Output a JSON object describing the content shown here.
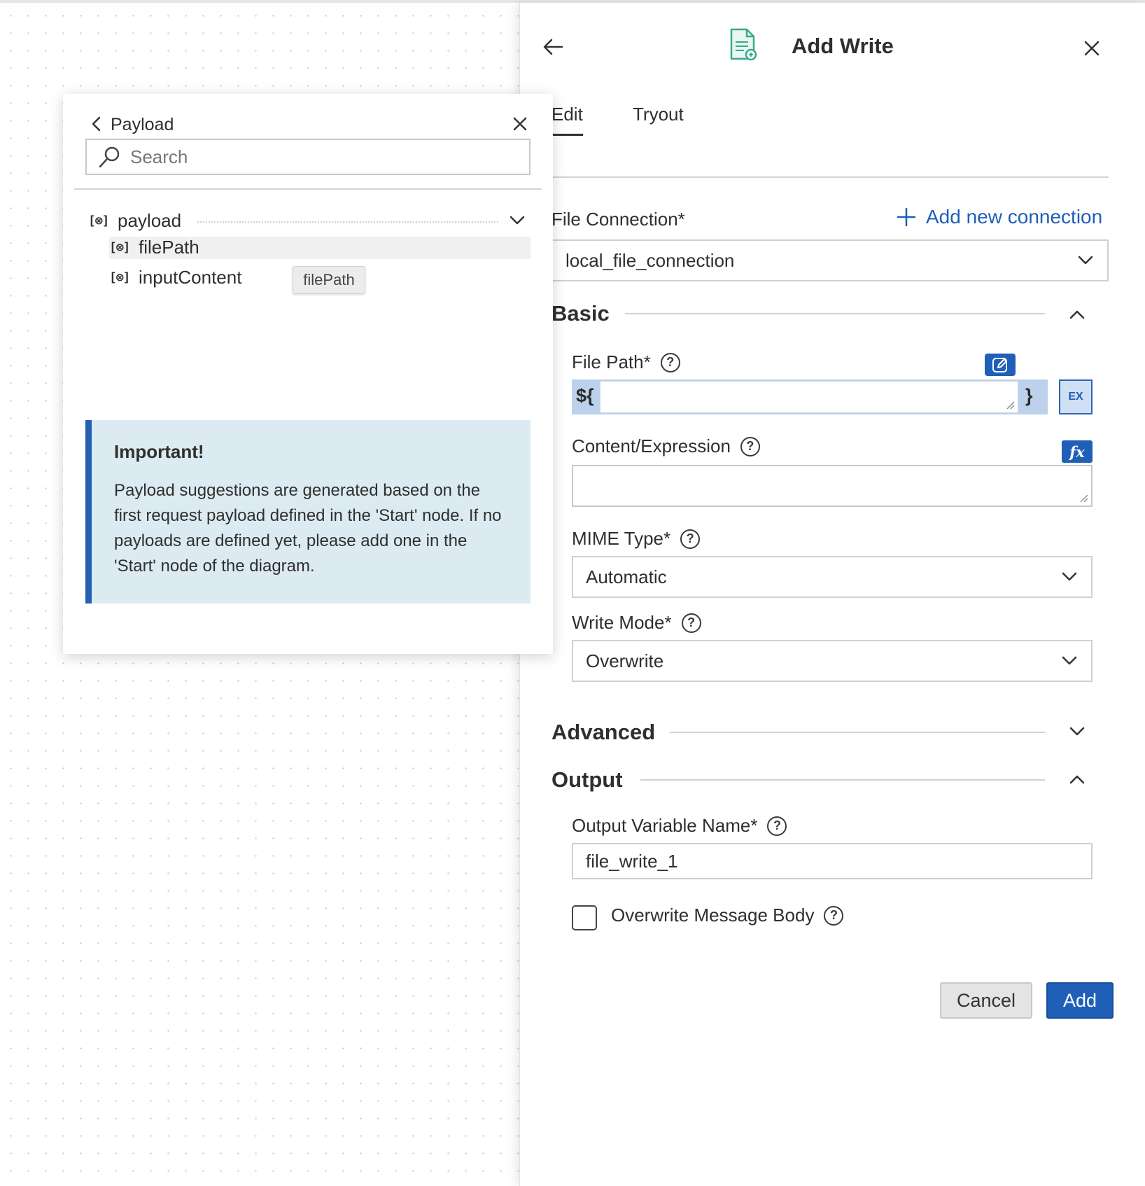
{
  "panel": {
    "title": "Add Write",
    "tabs": [
      {
        "label": "Edit",
        "active": true
      },
      {
        "label": "Tryout",
        "active": false
      }
    ],
    "file_connection": {
      "label": "File Connection*",
      "add_link": "Add new connection",
      "value": "local_file_connection"
    },
    "sections": {
      "basic": "Basic",
      "advanced": "Advanced",
      "output": "Output"
    },
    "file_path": {
      "label": "File Path*",
      "prefix": "${",
      "suffix": "}",
      "ex_label": "EX"
    },
    "content_expression": {
      "label": "Content/Expression",
      "fx_label": "fx"
    },
    "mime_type": {
      "label": "MIME Type*",
      "value": "Automatic"
    },
    "write_mode": {
      "label": "Write Mode*",
      "value": "Overwrite"
    },
    "output_variable": {
      "label": "Output Variable Name*",
      "value": "file_write_1"
    },
    "overwrite_body": {
      "label": "Overwrite Message Body",
      "checked": false
    },
    "buttons": {
      "cancel": "Cancel",
      "add": "Add"
    },
    "help_glyph": "?"
  },
  "popup": {
    "title": "Payload",
    "search_placeholder": "Search",
    "tree": {
      "root": "payload",
      "children": [
        "filePath",
        "inputContent"
      ]
    },
    "object_icon": "[⊗]",
    "tooltip": "filePath",
    "info": {
      "title": "Important!",
      "text": "Payload suggestions are generated based on the first request payload defined in the 'Start' node. If no payloads are defined yet, please add one in the 'Start' node of the diagram."
    }
  },
  "colors": {
    "accent": "#1f5fb8",
    "info_bg": "#dcebf1",
    "info_border": "#2660b4",
    "input_highlight": "#bcd2ec"
  }
}
